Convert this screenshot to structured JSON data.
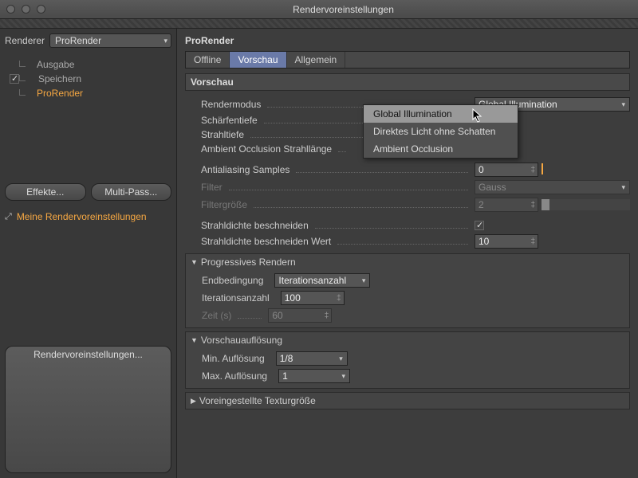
{
  "window": {
    "title": "Rendervoreinstellungen"
  },
  "left": {
    "renderer_label": "Renderer",
    "renderer_value": "ProRender",
    "tree": [
      "Ausgabe",
      "Speichern",
      "ProRender"
    ],
    "effects_btn": "Effekte...",
    "multipass_btn": "Multi-Pass...",
    "my_presets": "Meine Rendervoreinstellungen",
    "footer_btn": "Rendervoreinstellungen..."
  },
  "right": {
    "title": "ProRender",
    "tabs": [
      "Offline",
      "Vorschau",
      "Allgemein"
    ],
    "active_tab": 1,
    "section": "Vorschau",
    "rendermodus_label": "Rendermodus",
    "rendermodus_value": "Global Illumination",
    "rendermodus_options": [
      "Global Illumination",
      "Direktes Licht ohne Schatten",
      "Ambient Occlusion"
    ],
    "schaerfentiefe_label": "Schärfentiefe",
    "strahltiefe_label": "Strahltiefe",
    "ao_strahl_label": "Ambient Occlusion Strahllänge",
    "aa_label": "Antialiasing Samples",
    "aa_value": "0",
    "filter_label": "Filter",
    "filter_value": "Gauss",
    "filtersize_label": "Filtergröße",
    "filtersize_value": "2",
    "strahl_cut_label": "Strahldichte beschneiden",
    "strahl_cut_val_label": "Strahldichte beschneiden Wert",
    "strahl_cut_val": "10",
    "prog_title": "Progressives Rendern",
    "endbed_label": "Endbedingung",
    "endbed_value": "Iterationsanzahl",
    "iter_label": "Iterationsanzahl",
    "iter_value": "100",
    "zeit_label": "Zeit (s)",
    "zeit_value": "60",
    "vres_title": "Vorschauauflösung",
    "minres_label": "Min. Auflösung",
    "minres_value": "1/8",
    "maxres_label": "Max. Auflösung",
    "maxres_value": "1",
    "tex_title": "Voreingestellte Texturgröße"
  }
}
